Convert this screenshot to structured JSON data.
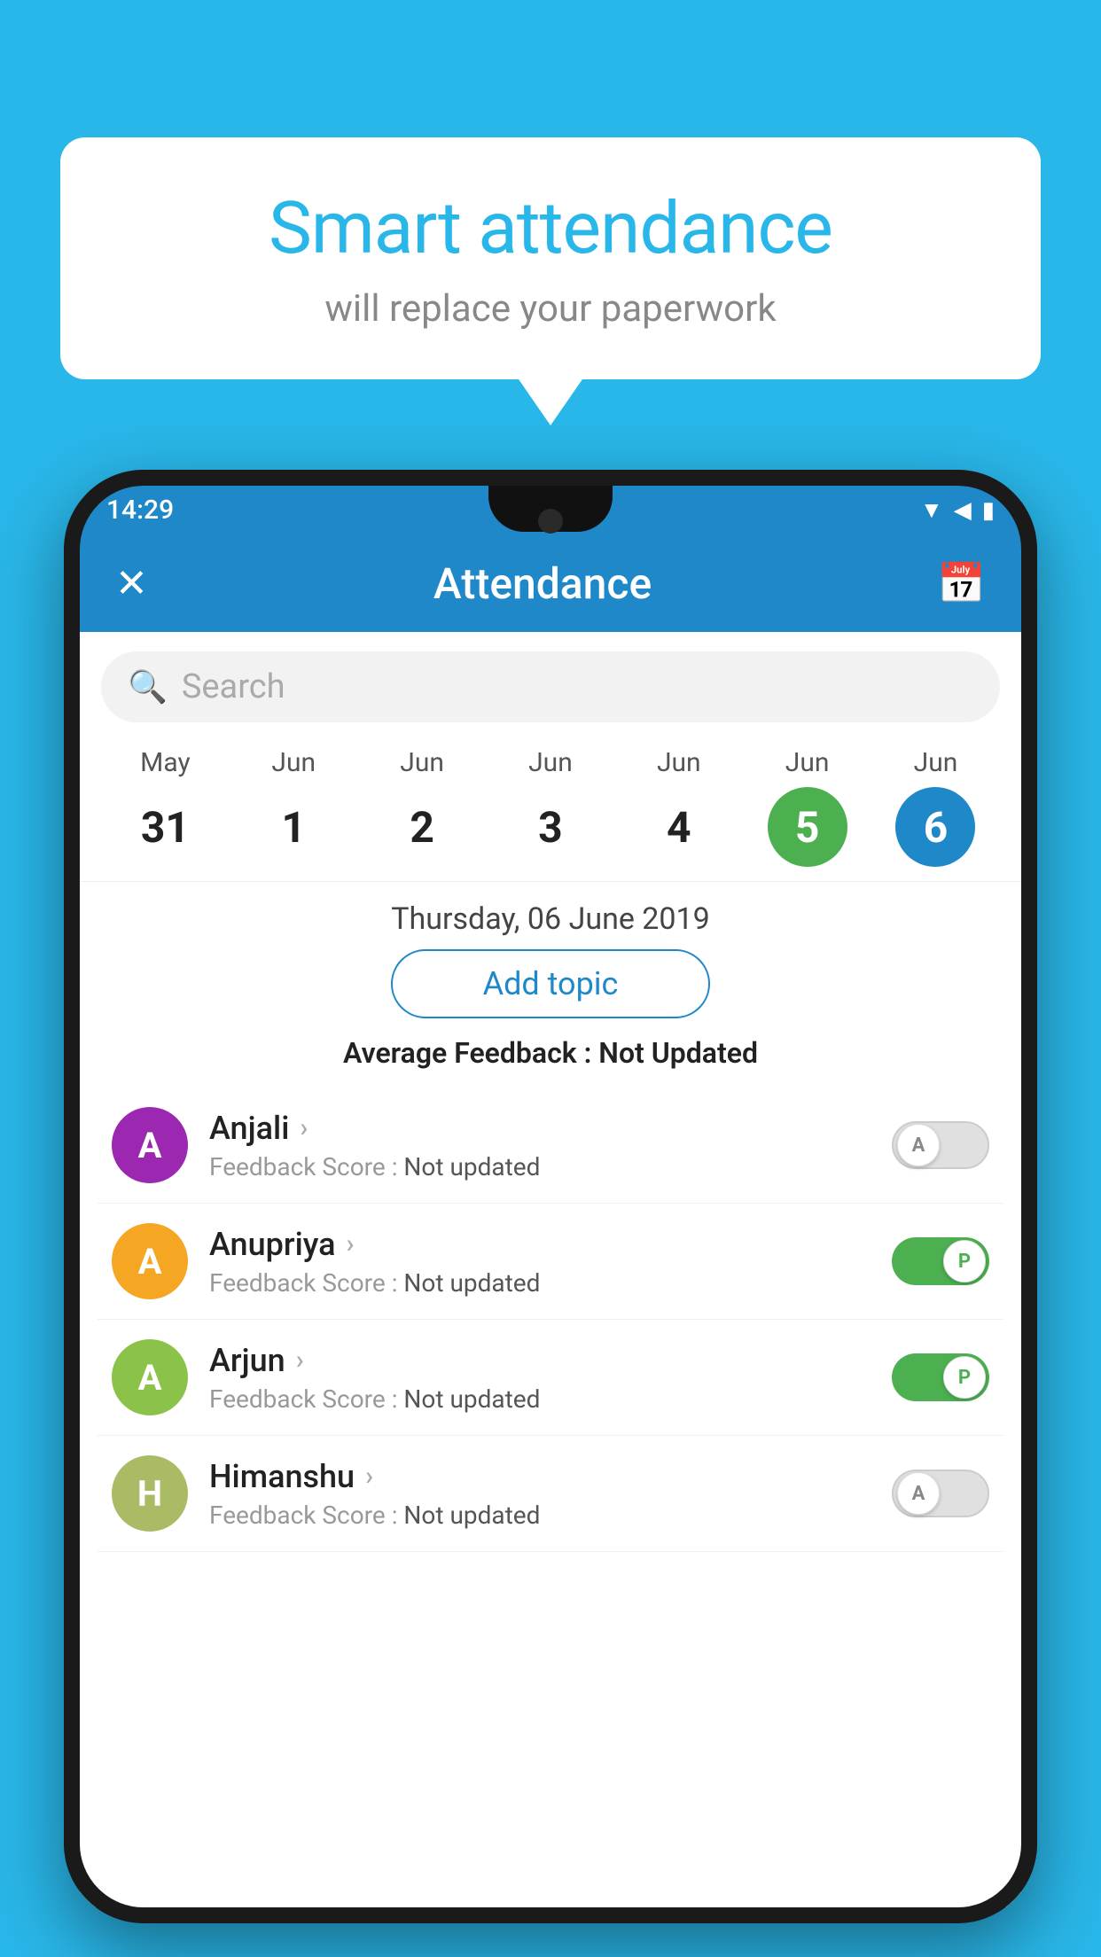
{
  "background_color": "#29b6e8",
  "speech_bubble": {
    "title": "Smart attendance",
    "subtitle": "will replace your paperwork"
  },
  "status_bar": {
    "time": "14:29",
    "icons": [
      "wifi",
      "signal",
      "battery"
    ]
  },
  "app_bar": {
    "title": "Attendance",
    "close_label": "✕",
    "calendar_label": "📅"
  },
  "search": {
    "placeholder": "Search"
  },
  "calendar": {
    "days": [
      {
        "month": "May",
        "date": "31",
        "style": "normal"
      },
      {
        "month": "Jun",
        "date": "1",
        "style": "normal"
      },
      {
        "month": "Jun",
        "date": "2",
        "style": "normal"
      },
      {
        "month": "Jun",
        "date": "3",
        "style": "normal"
      },
      {
        "month": "Jun",
        "date": "4",
        "style": "normal"
      },
      {
        "month": "Jun",
        "date": "5",
        "style": "today"
      },
      {
        "month": "Jun",
        "date": "6",
        "style": "selected"
      }
    ]
  },
  "selected_date_label": "Thursday, 06 June 2019",
  "add_topic_label": "Add topic",
  "average_feedback": {
    "label": "Average Feedback :",
    "value": "Not Updated"
  },
  "students": [
    {
      "name": "Anjali",
      "avatar_letter": "A",
      "avatar_color": "#9c27b0",
      "feedback_label": "Feedback Score :",
      "feedback_value": "Not updated",
      "toggle": "off",
      "toggle_letter": "A"
    },
    {
      "name": "Anupriya",
      "avatar_letter": "A",
      "avatar_color": "#f5a623",
      "feedback_label": "Feedback Score :",
      "feedback_value": "Not updated",
      "toggle": "on",
      "toggle_letter": "P"
    },
    {
      "name": "Arjun",
      "avatar_letter": "A",
      "avatar_color": "#8bc34a",
      "feedback_label": "Feedback Score :",
      "feedback_value": "Not updated",
      "toggle": "on",
      "toggle_letter": "P"
    },
    {
      "name": "Himanshu",
      "avatar_letter": "H",
      "avatar_color": "#aabb66",
      "feedback_label": "Feedback Score :",
      "feedback_value": "Not updated",
      "toggle": "off",
      "toggle_letter": "A"
    }
  ]
}
